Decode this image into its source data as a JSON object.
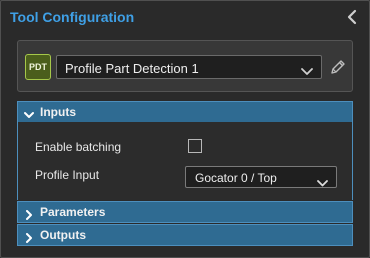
{
  "header": {
    "title": "Tool Configuration"
  },
  "tool": {
    "badge": "PDT",
    "selected": "Profile Part Detection 1"
  },
  "sections": {
    "inputs": {
      "label": "Inputs",
      "expanded": true
    },
    "parameters": {
      "label": "Parameters",
      "expanded": false
    },
    "outputs": {
      "label": "Outputs",
      "expanded": false
    }
  },
  "inputs": {
    "enable_batching": {
      "label": "Enable batching",
      "checked": false
    },
    "profile_input": {
      "label": "Profile Input",
      "value": "Gocator 0 / Top"
    }
  },
  "colors": {
    "accent": "#3fa0e6",
    "section_header": "#2f6b92",
    "badge_bg": "#4b5e1c",
    "badge_border": "#a6c84a"
  }
}
